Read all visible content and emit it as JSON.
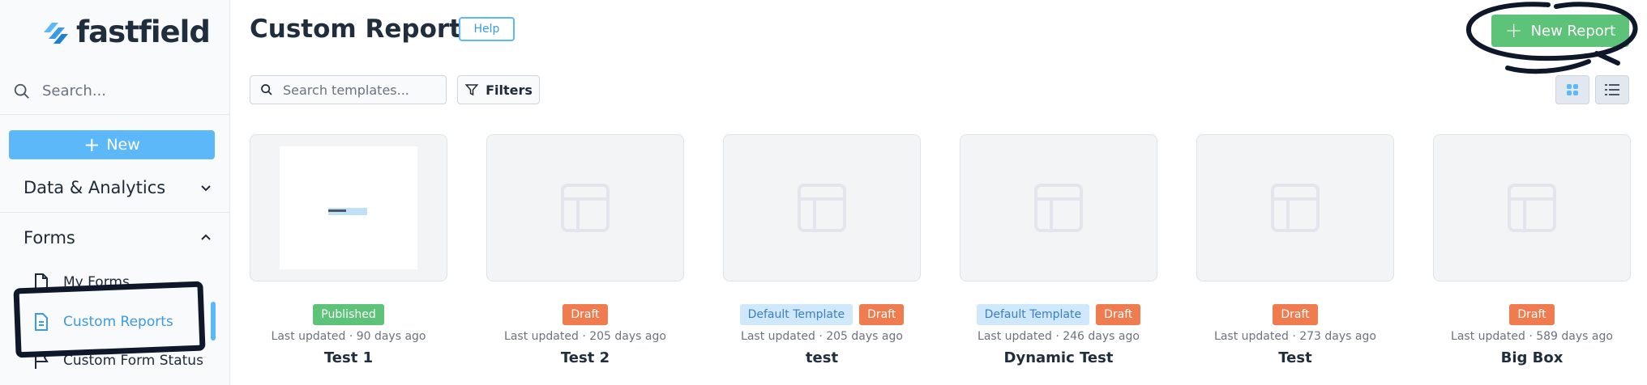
{
  "app": {
    "name": "fastfield"
  },
  "sidebar": {
    "search_placeholder": "Search...",
    "new_label": "New",
    "sections": [
      {
        "label": "Data & Analytics",
        "expanded": false
      },
      {
        "label": "Forms",
        "expanded": true
      }
    ],
    "items": [
      {
        "label": "My Forms",
        "active": false
      },
      {
        "label": "Custom Reports",
        "active": true
      },
      {
        "label": "Custom Form Status",
        "active": false
      }
    ]
  },
  "header": {
    "title": "Custom Reports",
    "help_label": "Help",
    "new_report_label": "New Report"
  },
  "toolbar": {
    "search_placeholder": "Search templates...",
    "filters_label": "Filters",
    "view_mode": "grid"
  },
  "cards": [
    {
      "title": "Test 1",
      "updated": "Last updated · 90 days ago",
      "badges": [
        "Published"
      ],
      "preview": true
    },
    {
      "title": "Test 2",
      "updated": "Last updated · 205 days ago",
      "badges": [
        "Draft"
      ],
      "preview": false
    },
    {
      "title": "test",
      "updated": "Last updated · 205 days ago",
      "badges": [
        "Default Template",
        "Draft"
      ],
      "preview": false
    },
    {
      "title": "Dynamic Test",
      "updated": "Last updated · 246 days ago",
      "badges": [
        "Default Template",
        "Draft"
      ],
      "preview": false
    },
    {
      "title": "Test",
      "updated": "Last updated · 273 days ago",
      "badges": [
        "Draft"
      ],
      "preview": false
    },
    {
      "title": "Big Box",
      "updated": "Last updated · 589 days ago",
      "badges": [
        "Draft"
      ],
      "preview": false
    }
  ],
  "colors": {
    "accent_blue": "#5db8fa",
    "green": "#5cc378",
    "draft_orange": "#ef7b4f",
    "default_badge_bg": "#cfe8fb",
    "dark_text": "#1f2d3d"
  },
  "icons": {
    "logo": "fastfield-logo-icon",
    "search": "search-icon",
    "plus": "plus-icon",
    "chevron_down": "chevron-down-icon",
    "chevron_up": "chevron-up-icon",
    "document": "document-icon",
    "flag": "flag-icon",
    "filter": "filter-icon",
    "grid": "grid-view-icon",
    "list": "list-view-icon",
    "template": "template-layout-icon"
  }
}
